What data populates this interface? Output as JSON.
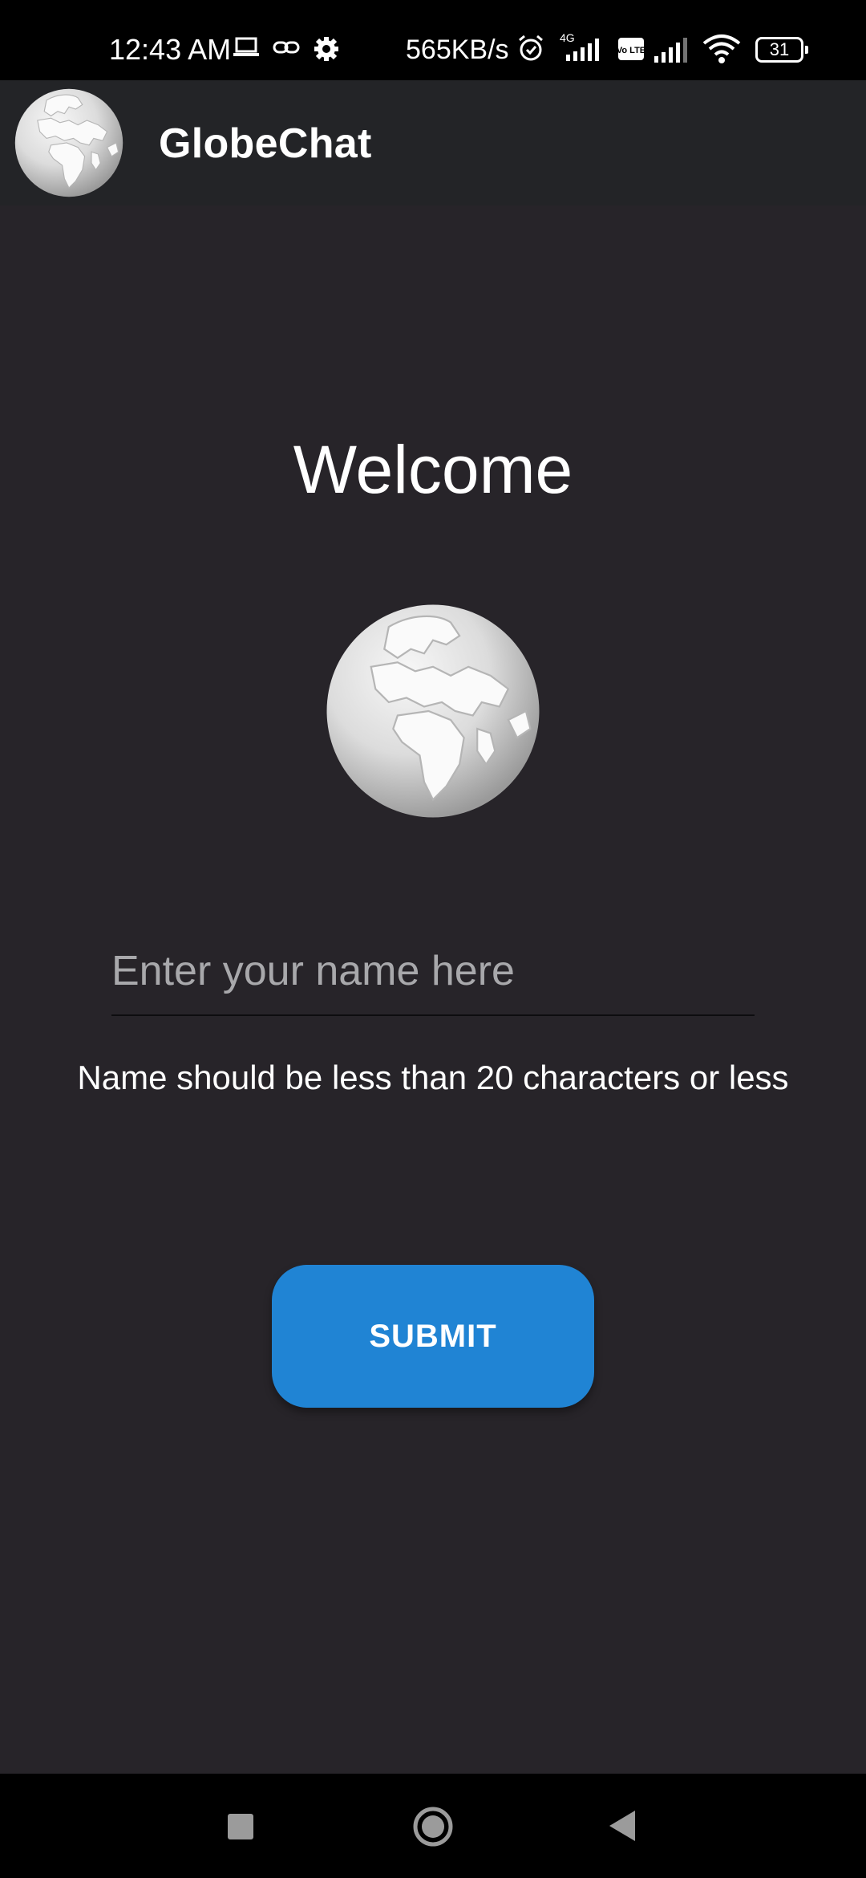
{
  "status_bar": {
    "time": "12:43 AM",
    "net_speed": "565KB/s",
    "network_type": "4G",
    "volte": "Vo LTE",
    "battery_level": "31",
    "icons": [
      "laptop-icon",
      "link-icon",
      "gear-icon",
      "alarm-icon",
      "signal-icon",
      "volte-icon",
      "signal-icon",
      "wifi-icon",
      "battery-icon"
    ]
  },
  "app_bar": {
    "title": "GlobeChat",
    "logo": "globe-icon"
  },
  "main": {
    "welcome": "Welcome",
    "name_input": {
      "placeholder": "Enter your name here",
      "value": ""
    },
    "hint": "Name should be less than 20 characters or less",
    "submit_label": "SUBMIT"
  },
  "nav_bar": {
    "icons": [
      "recents-icon",
      "home-icon",
      "back-icon"
    ]
  },
  "colors": {
    "background": "#272429",
    "app_bar": "#232427",
    "accent": "#2084d4",
    "text": "#ffffff",
    "placeholder": "#a8a8ab"
  }
}
